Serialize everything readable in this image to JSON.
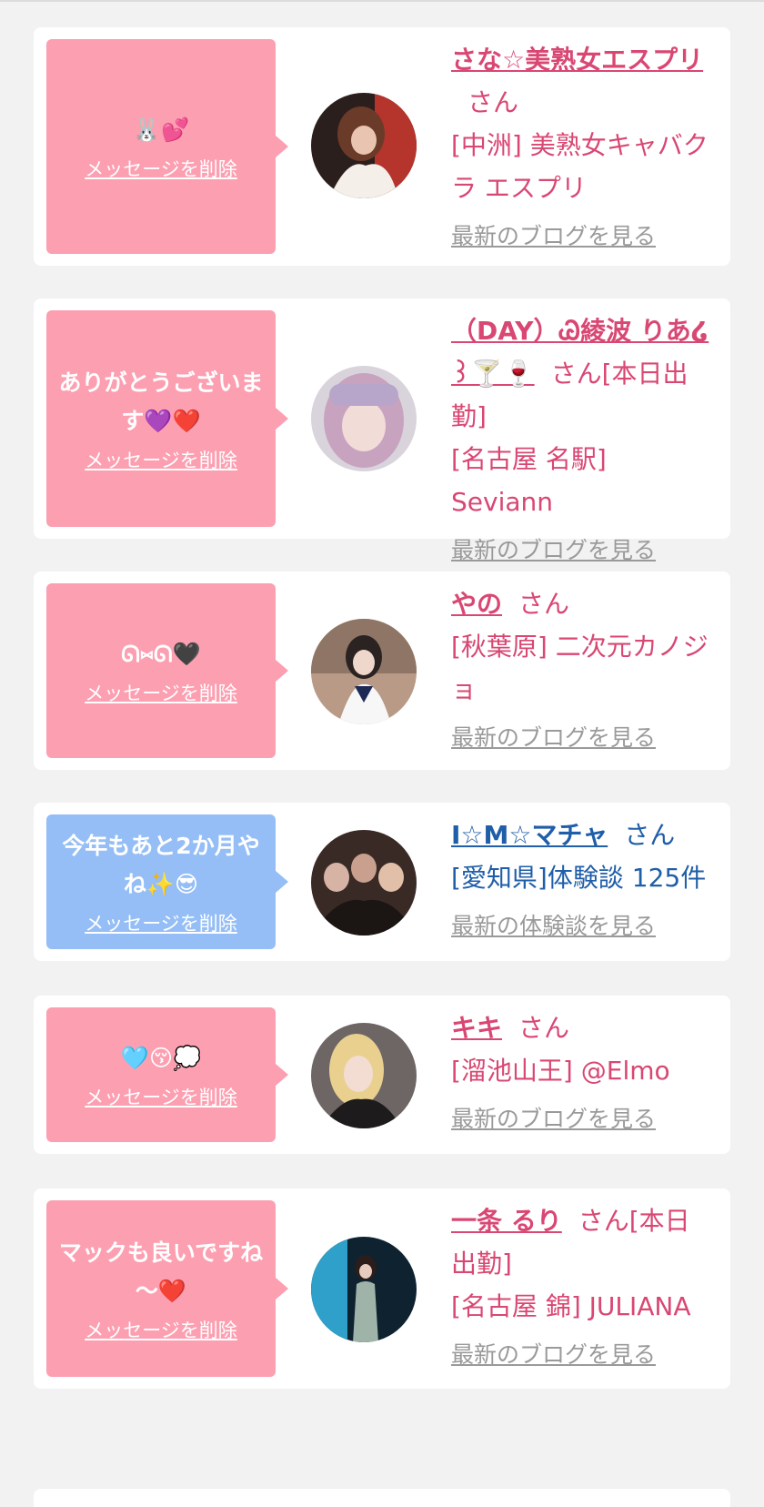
{
  "messages": [
    {
      "message": "🐰💕",
      "delete_label": "メッセージを削除",
      "name": "さな☆美熟女エスプリ",
      "honorific": "さん",
      "shop": "[中洲] 美熟女キャバクラ エスプリ",
      "link": "最新のブログを見る",
      "theme": "pink"
    },
    {
      "message": "ありがとうございます💜❤️",
      "delete_label": "メッセージを削除",
      "name": "（DAY）Ꮚ綾波 りあ໒꒱🍸🍷",
      "honorific": "さん[本日出勤]",
      "shop": "[名古屋 名駅] Seviann",
      "link": "最新のブログを見る",
      "theme": "pink"
    },
    {
      "message": "ᘏ⑅ᘏ🖤",
      "delete_label": "メッセージを削除",
      "name": "やの",
      "honorific": "さん",
      "shop": "[秋葉原] 二次元カノジョ",
      "link": "最新のブログを見る",
      "theme": "pink"
    },
    {
      "message": "今年もあと2か月やね✨😎",
      "delete_label": "メッセージを削除",
      "name": "I☆M☆マチャ",
      "honorific": "さん",
      "shop": "[愛知県]体験談 125件",
      "link": "最新の体験談を見る",
      "theme": "blue"
    },
    {
      "message": "🩵😚💭",
      "delete_label": "メッセージを削除",
      "name": "キキ",
      "honorific": "さん",
      "shop": "[溜池山王] @Elmo",
      "link": "最新のブログを見る",
      "theme": "pink"
    },
    {
      "message": "マックも良いですね～❤️",
      "delete_label": "メッセージを削除",
      "name": "一条 るり",
      "honorific": "さん[本日出勤]",
      "shop": "[名古屋 錦] JULIANA",
      "link": "最新のブログを見る",
      "theme": "pink"
    }
  ],
  "colors": {
    "background": "#f2f2f2",
    "bubble_pink": "#fc9fb1",
    "bubble_blue": "#94bef5",
    "name_pink": "#d94773",
    "name_blue": "#1f5ea8",
    "link_gray": "#9a9a9a"
  }
}
